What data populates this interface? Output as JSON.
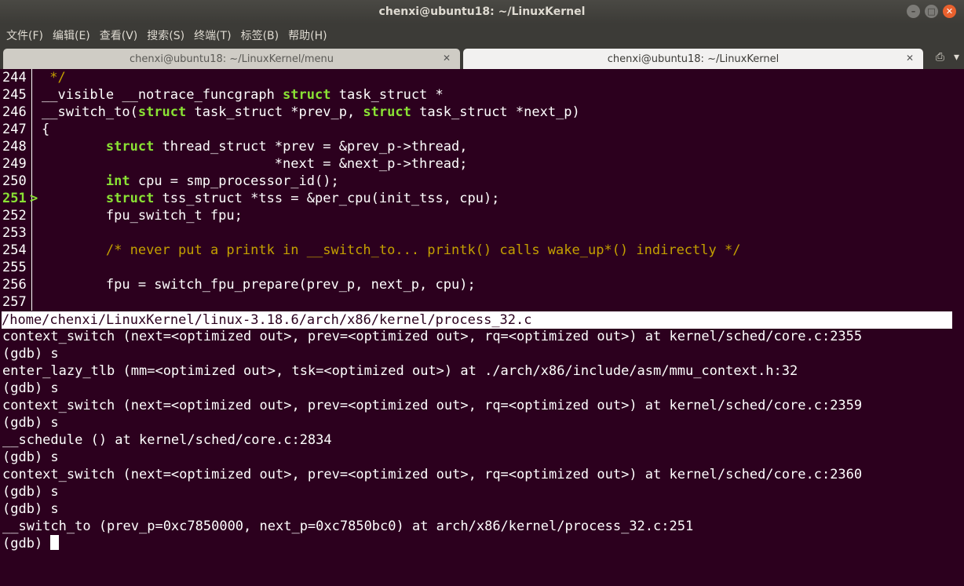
{
  "window": {
    "title": "chenxi@ubuntu18: ~/LinuxKernel"
  },
  "menu": [
    "文件(F)",
    "编辑(E)",
    "查看(V)",
    "搜索(S)",
    "终端(T)",
    "标签(B)",
    "帮助(H)"
  ],
  "tabs": [
    {
      "label": "chenxi@ubuntu18: ~/LinuxKernel/menu",
      "active": false
    },
    {
      "label": "chenxi@ubuntu18: ~/LinuxKernel",
      "active": true
    }
  ],
  "source": {
    "current_line": "251",
    "marker": ">",
    "lines": [
      {
        "num": "244",
        "parts": [
          {
            "t": " */",
            "c": "cm"
          }
        ]
      },
      {
        "num": "245",
        "parts": [
          {
            "t": "__visible __notrace_funcgraph "
          },
          {
            "t": "struct",
            "c": "kw"
          },
          {
            "t": " task_struct *"
          }
        ]
      },
      {
        "num": "246",
        "parts": [
          {
            "t": "__switch_to("
          },
          {
            "t": "struct",
            "c": "kw"
          },
          {
            "t": " task_struct *prev_p, "
          },
          {
            "t": "struct",
            "c": "kw"
          },
          {
            "t": " task_struct *next_p)"
          }
        ]
      },
      {
        "num": "247",
        "parts": [
          {
            "t": "{"
          }
        ]
      },
      {
        "num": "248",
        "parts": [
          {
            "t": "        "
          },
          {
            "t": "struct",
            "c": "kw"
          },
          {
            "t": " thread_struct *prev = &prev_p->thread,"
          }
        ]
      },
      {
        "num": "249",
        "parts": [
          {
            "t": "                             *next = &next_p->thread;"
          }
        ]
      },
      {
        "num": "250",
        "parts": [
          {
            "t": "        "
          },
          {
            "t": "int",
            "c": "kw"
          },
          {
            "t": " cpu = smp_processor_id();"
          }
        ]
      },
      {
        "num": "251",
        "parts": [
          {
            "t": "        "
          },
          {
            "t": "struct",
            "c": "kw"
          },
          {
            "t": " tss_struct *tss = &per_cpu(init_tss, cpu);"
          }
        ]
      },
      {
        "num": "252",
        "parts": [
          {
            "t": "        fpu_switch_t fpu;"
          }
        ]
      },
      {
        "num": "253",
        "parts": []
      },
      {
        "num": "254",
        "parts": [
          {
            "t": "        "
          },
          {
            "t": "/* never put a printk in __switch_to... printk() calls wake_up*() indirectly */",
            "c": "cm"
          }
        ]
      },
      {
        "num": "255",
        "parts": []
      },
      {
        "num": "256",
        "parts": [
          {
            "t": "        fpu = switch_fpu_prepare(prev_p, next_p, cpu);"
          }
        ]
      },
      {
        "num": "257",
        "parts": []
      }
    ]
  },
  "status": {
    "path": "/home/chenxi/LinuxKernel/linux-3.18.6/arch/x86/kernel/process_32.c"
  },
  "console": {
    "lines": [
      "context_switch (next=<optimized out>, prev=<optimized out>, rq=<optimized out>) at kernel/sched/core.c:2355",
      "(gdb) s",
      "enter_lazy_tlb (mm=<optimized out>, tsk=<optimized out>) at ./arch/x86/include/asm/mmu_context.h:32",
      "(gdb) s",
      "context_switch (next=<optimized out>, prev=<optimized out>, rq=<optimized out>) at kernel/sched/core.c:2359",
      "(gdb) s",
      "__schedule () at kernel/sched/core.c:2834",
      "(gdb) s",
      "context_switch (next=<optimized out>, prev=<optimized out>, rq=<optimized out>) at kernel/sched/core.c:2360",
      "(gdb) s",
      "(gdb) s",
      "__switch_to (prev_p=0xc7850000, next_p=0xc7850bc0) at arch/x86/kernel/process_32.c:251"
    ],
    "prompt": "(gdb) "
  }
}
